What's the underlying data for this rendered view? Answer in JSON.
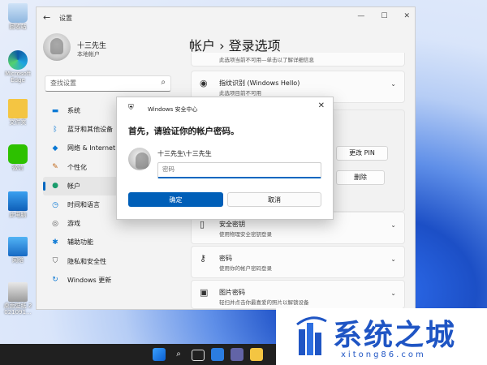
{
  "colors": {
    "accent": "#0067c0",
    "primary_button": "#005fb8",
    "taskbar": "#202020",
    "watermark": "#1f55c4"
  },
  "desktop": {
    "icons": [
      {
        "label": "回收站",
        "icon": "recycle-bin-icon"
      },
      {
        "label": "Microsoft Edge",
        "icon": "edge-icon"
      },
      {
        "label": "文件夹",
        "icon": "folder-icon"
      },
      {
        "label": "微信",
        "icon": "wechat-icon"
      },
      {
        "label": "此电脑",
        "icon": "this-pc-icon"
      },
      {
        "label": "网络",
        "icon": "network-icon"
      },
      {
        "label": "桌面壁纸 2021091...",
        "icon": "image-file-icon"
      }
    ]
  },
  "settings": {
    "window_title": "设置",
    "user": {
      "name": "十三先生",
      "account_type": "本地帐户"
    },
    "search": {
      "placeholder": "查找设置"
    },
    "nav": [
      {
        "label": "系统",
        "icon": "monitor-icon"
      },
      {
        "label": "蓝牙和其他设备",
        "icon": "bluetooth-icon"
      },
      {
        "label": "网络 & Internet",
        "icon": "wifi-icon"
      },
      {
        "label": "个性化",
        "icon": "brush-icon"
      },
      {
        "label": "帐户",
        "icon": "person-icon",
        "active": true
      },
      {
        "label": "时间和语言",
        "icon": "globe-clock-icon"
      },
      {
        "label": "游戏",
        "icon": "gamepad-icon"
      },
      {
        "label": "辅助功能",
        "icon": "accessibility-icon"
      },
      {
        "label": "隐私和安全性",
        "icon": "shield-icon"
      },
      {
        "label": "Windows 更新",
        "icon": "update-icon"
      }
    ],
    "page_title": "帐户 › 登录选项",
    "top_card_subtitle": "此选项当前不可用—单击以了解详细信息",
    "fingerprint": {
      "title": "指纹识别 (Windows Hello)",
      "subtitle": "此选项目前不可用"
    },
    "pin_buttons": {
      "change": "更改 PIN",
      "remove": "删除"
    },
    "security_key": {
      "title": "安全密钥",
      "subtitle": "使用物理安全密钥登录"
    },
    "password": {
      "title": "密码",
      "subtitle": "使用你的帐户密码登录"
    },
    "picture_password": {
      "title": "图片密码",
      "subtitle": "轻扫并点击你最喜爱的照片以解锁设备"
    }
  },
  "dialog": {
    "title": "Windows 安全中心",
    "heading": "首先，请验证你的帐户密码。",
    "account": "十三先生\\十三先生",
    "password_placeholder": "密码",
    "ok": "确定",
    "cancel": "取消"
  },
  "watermark": {
    "text": "系统之城",
    "url": "xitong86.com"
  }
}
